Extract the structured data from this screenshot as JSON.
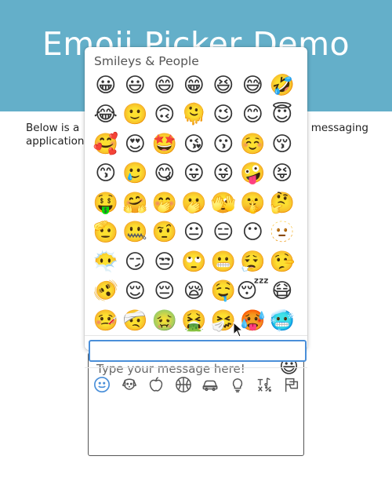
{
  "header": {
    "title": "Emoji Picker Demo"
  },
  "intro": {
    "line1_start": "Below is a",
    "line1_end": "messaging",
    "line2": "application."
  },
  "picker": {
    "category_title": "Smileys & People",
    "emojis": [
      "😀",
      "😃",
      "😄",
      "😁",
      "😆",
      "😅",
      "🤣",
      "😂",
      "🙂",
      "🙃",
      "🫠",
      "😉",
      "😊",
      "😇",
      "🥰",
      "😍",
      "🤩",
      "😘",
      "😗",
      "☺️",
      "😚",
      "😙",
      "🥲",
      "😋",
      "😛",
      "😜",
      "🤪",
      "😝",
      "🤑",
      "🤗",
      "🤭",
      "🫢",
      "🫣",
      "🤫",
      "🤔",
      "🫡",
      "🤐",
      "🤨",
      "😐",
      "😑",
      "😶",
      "🫥",
      "😶‍🌫️",
      "😏",
      "😒",
      "🙄",
      "😬",
      "😮‍💨",
      "🤥",
      "🫨",
      "😌",
      "😔",
      "😪",
      "🤤",
      "😴",
      "😷",
      "🤒",
      "🤕",
      "🤢",
      "🤮",
      "🤧",
      "🥵",
      "🥶"
    ],
    "search_value": "",
    "categories": [
      {
        "name": "smileys",
        "icon": "smiley-icon"
      },
      {
        "name": "animals",
        "icon": "dog-icon"
      },
      {
        "name": "food",
        "icon": "apple-icon"
      },
      {
        "name": "activity",
        "icon": "basketball-icon"
      },
      {
        "name": "travel",
        "icon": "car-icon"
      },
      {
        "name": "objects",
        "icon": "lightbulb-icon"
      },
      {
        "name": "symbols",
        "icon": "symbols-icon"
      },
      {
        "name": "flags",
        "icon": "flag-icon"
      }
    ],
    "active_color": "#4a8fd9"
  },
  "message": {
    "placeholder": "Type your message here!",
    "emoji_button": "😃"
  }
}
